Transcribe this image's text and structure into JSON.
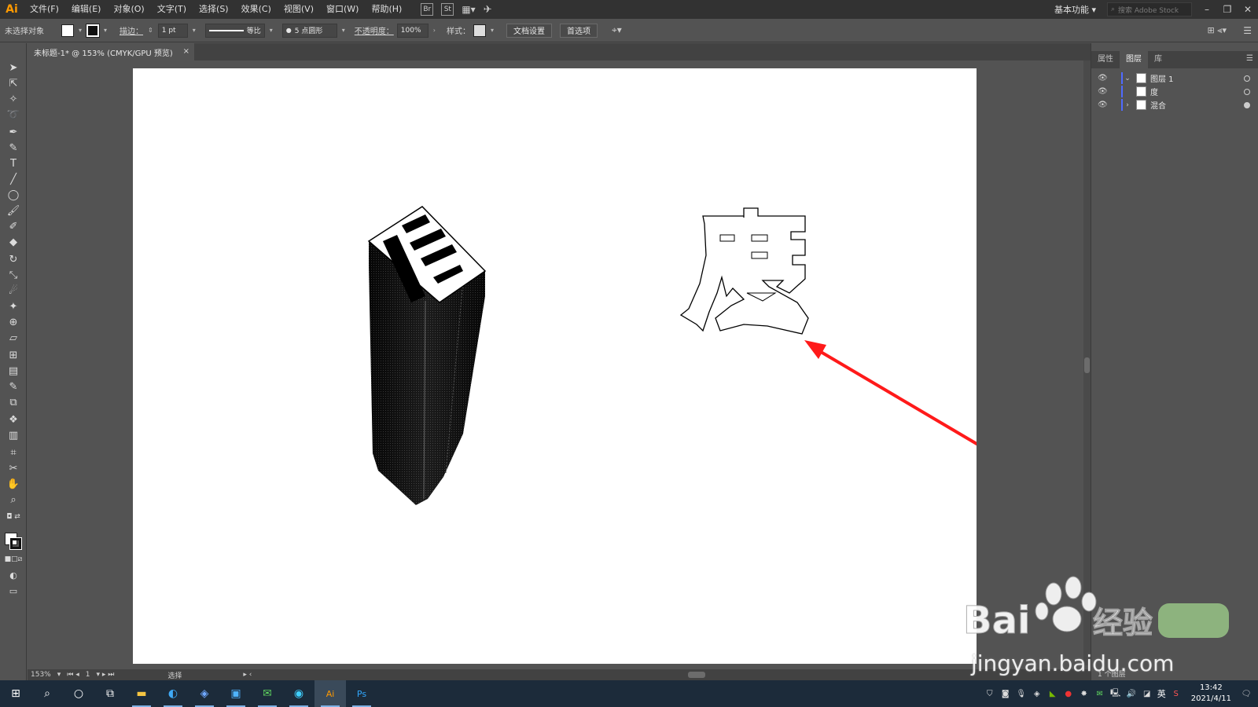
{
  "app": {
    "logo": "Ai"
  },
  "menubar": {
    "items": [
      "文件(F)",
      "编辑(E)",
      "对象(O)",
      "文字(T)",
      "选择(S)",
      "效果(C)",
      "视图(V)",
      "窗口(W)",
      "帮助(H)"
    ],
    "br_label": "Br",
    "st_label": "St",
    "workspace": "基本功能",
    "search_placeholder": "搜索 Adobe Stock"
  },
  "controlbar": {
    "selection": "未选择对象",
    "stroke_label": "描边：",
    "stroke_weight": "1 pt",
    "profile": "等比",
    "brush": "5 点圆形",
    "opacity_label": "不透明度：",
    "opacity_value": "100%",
    "style_label": "样式：",
    "doc_setup": "文档设置",
    "preferences": "首选项"
  },
  "tab": {
    "title": "未标题-1* @ 153% (CMYK/GPU 预览)",
    "close": "×"
  },
  "statusbar": {
    "zoom": "153%",
    "page": "1",
    "tool": "选择"
  },
  "panels": {
    "tabs": [
      "属性",
      "图层",
      "库"
    ],
    "active_tab": "图层",
    "layers": [
      {
        "name": "图层 1",
        "expanded": true
      },
      {
        "name": "度",
        "expanded": false
      },
      {
        "name": "混合",
        "expanded": false
      }
    ],
    "layer_count": "1 个图层"
  },
  "canvas": {
    "glyph": "度",
    "arrow_color": "#ff1a1a"
  },
  "taskbar": {
    "time": "13:42",
    "date": "2021/4/11",
    "ime": "英"
  },
  "watermark": {
    "logo": "Baidu经验",
    "url": "jingyan.baidu.com"
  },
  "colors": {
    "accent_ai": "#ff9a00",
    "layer_bar": "#4f6bff",
    "taskbar": "#1c2b3a"
  }
}
